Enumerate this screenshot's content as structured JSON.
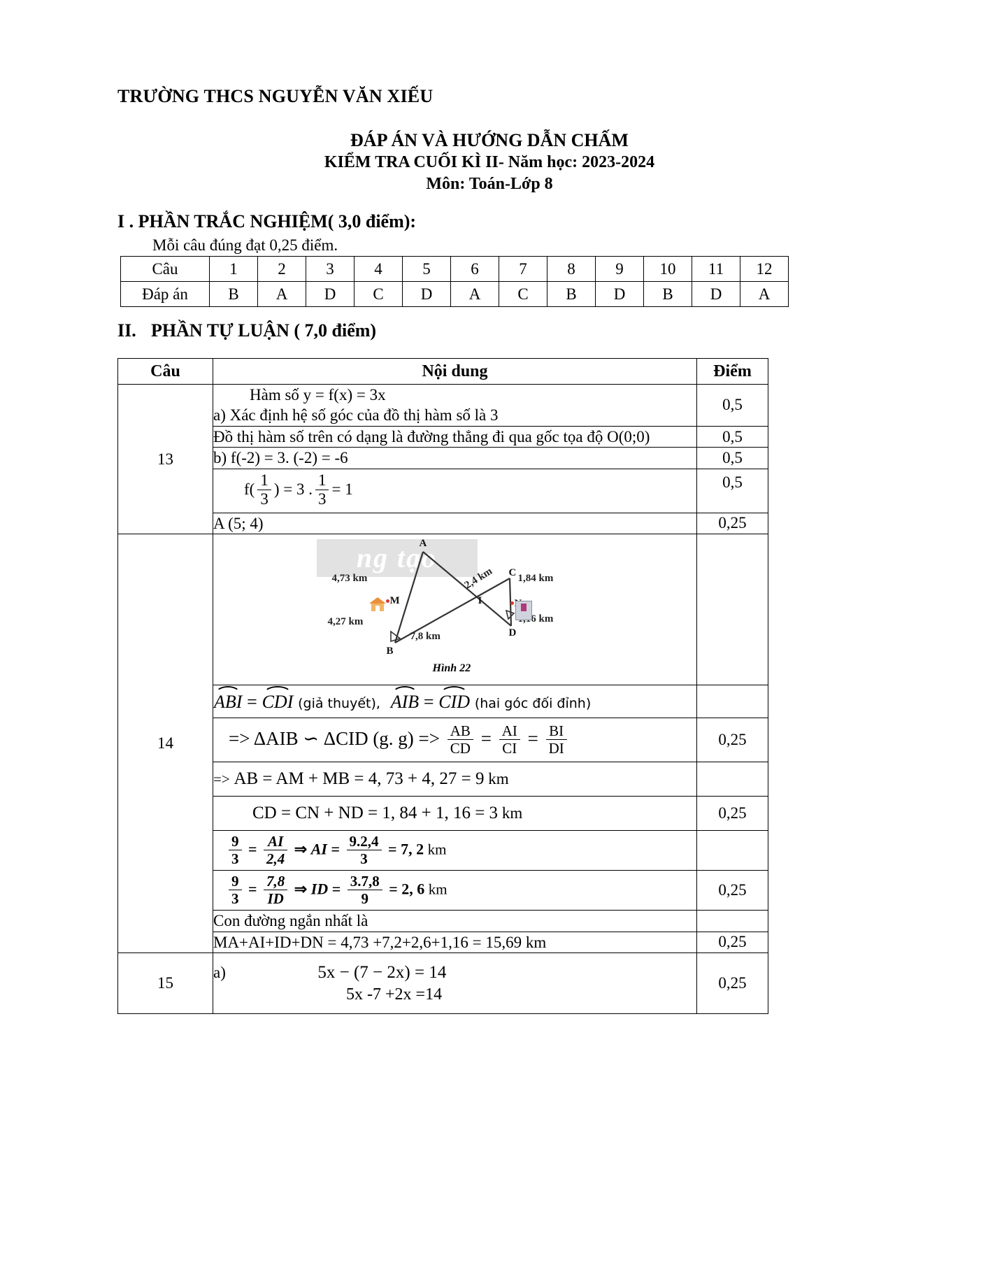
{
  "header": {
    "school": "TRƯỜNG THCS NGUYỄN VĂN XIẾU",
    "title_line1": "ĐÁP ÁN VÀ HƯỚNG DẪN CHẤM",
    "title_line2": "KIỂM TRA CUỐI KÌ II- Năm học: 2023-2024",
    "title_line3": "Môn: Toán-Lớp 8"
  },
  "section1": {
    "heading": "I . PHẦN TRẮC NGHIỆM( 3,0 điểm):",
    "note": "Mỗi câu đúng đạt 0,25 điểm.",
    "table": {
      "row_label_question": "Câu",
      "row_label_answer": "Đáp án",
      "questions": [
        "1",
        "2",
        "3",
        "4",
        "5",
        "6",
        "7",
        "8",
        "9",
        "10",
        "11",
        "12"
      ],
      "answers": [
        "B",
        "A",
        "D",
        "C",
        "D",
        "A",
        "C",
        "B",
        "D",
        "B",
        "D",
        "A"
      ]
    }
  },
  "section2": {
    "heading_number": "II.",
    "heading_text": "PHẦN TỰ LUẬN ( 7,0 điểm)",
    "table_headers": {
      "cau": "Câu",
      "noi_dung": "Nội dung",
      "diem": "Điểm"
    },
    "q13": {
      "number": "13",
      "line_func": "Hàm số y = f(x) = 3x",
      "line_a": "a) Xác định hệ số góc của đồ thị hàm số là 3",
      "line_graph": "Đồ thị hàm số trên có dạng là đường thẳng đi qua gốc tọa độ O(0;0)",
      "line_b": "b) f(-2) = 3. (-2) = -6",
      "frac_f": "f(",
      "frac_num": "1",
      "frac_den": "3",
      "frac_mid": ") = 3 .",
      "frac_eq": "= 1",
      "line_point": "A (5; 4)",
      "points": {
        "a1": "0,5",
        "a2": "0,5",
        "b1": "0,5",
        "b2": "0,5",
        "pt": "0,25"
      }
    },
    "q14": {
      "number": "14",
      "figure": {
        "watermark": "ng tạo",
        "caption": "Hình 22",
        "labels": {
          "A": "A",
          "B": "B",
          "C": "C",
          "D": "D",
          "M": "M",
          "N": "N",
          "I": "I",
          "len_AM": "4,73 km",
          "len_MB": "4,27 km",
          "len_BI": "7,8 km",
          "len_IC": "2,4 km",
          "len_CN": "1,84 km",
          "len_ND": "1,16 km"
        }
      },
      "angle_line": {
        "ang1": "ABI",
        "eq1": "=",
        "ang2": "CDI",
        "note1": "(giả thuyết)",
        "comma": ",",
        "ang3": "AIB",
        "eq2": "=",
        "ang4": "CID",
        "note2": "(hai góc đối đỉnh)"
      },
      "similar_line": {
        "prefix": "=> ΔAIB",
        "sim": "∽",
        "mid": "ΔCID (g. g) =>",
        "f1_num": "AB",
        "f1_den": "CD",
        "eq_a": "=",
        "f2_num": "AI",
        "f2_den": "CI",
        "eq_b": "=",
        "f3_num": "BI",
        "f3_den": "DI"
      },
      "line_AB": "AB = AM + MB = 4, 73 + 4, 27 = 9",
      "line_AB_unit": "km",
      "arrow": "=>",
      "line_CD": "CD = CN + ND = 1, 84 + 1, 16 = 3",
      "line_CD_unit": "km",
      "ratio1": {
        "l_num": "9",
        "l_den": "3",
        "eq": "=",
        "m_num": "AI",
        "m_den": "2,4",
        "imp": "⇒",
        "var": "AI",
        "eq2": "=",
        "r_num": "9.2,4",
        "r_den": "3",
        "res": "= 7, 2",
        "unit": "km"
      },
      "ratio2": {
        "l_num": "9",
        "l_den": "3",
        "eq": "=",
        "m_num": "7,8",
        "m_den": "ID",
        "imp": "⇒",
        "var": "ID",
        "eq2": "=",
        "r_num": "3.7,8",
        "r_den": "9",
        "res": "= 2, 6",
        "unit": "km"
      },
      "shortest_label": "Con đường ngắn nhất là",
      "shortest_calc": "MA+AI+ID+DN = 4,73 +7,2+2,6+1,16 = 15,69 km",
      "points": {
        "p1": "0,25",
        "p2": "0,25",
        "p3": "0,25",
        "p4": "0,25"
      }
    },
    "q15": {
      "number": "15",
      "label_a": "a)",
      "eq1": "5x − (7 − 2x) = 14",
      "eq2": "5x -7 +2x =14",
      "points": {
        "p1": "0,25"
      }
    }
  }
}
